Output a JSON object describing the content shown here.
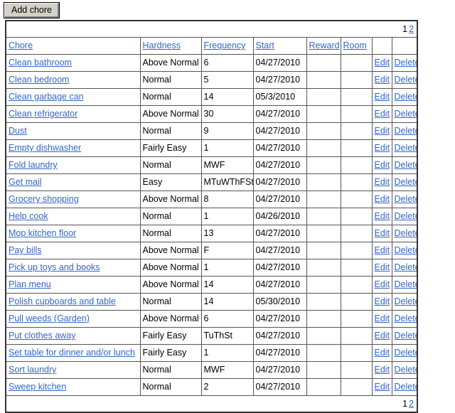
{
  "toolbar": {
    "add_chore_label": "Add chore"
  },
  "pager": {
    "current_page": "1",
    "next_page": "2"
  },
  "table": {
    "columns": [
      {
        "key": "chore",
        "label": "Chore",
        "link": true
      },
      {
        "key": "hard",
        "label": "Hardness",
        "link": true
      },
      {
        "key": "freq",
        "label": "Frequency",
        "link": true
      },
      {
        "key": "start",
        "label": "Start",
        "link": true
      },
      {
        "key": "reward",
        "label": "Reward",
        "link": true
      },
      {
        "key": "room",
        "label": "Room",
        "link": true
      },
      {
        "key": "edit",
        "label": "",
        "link": false
      },
      {
        "key": "delete",
        "label": "",
        "link": false
      }
    ],
    "row_actions": {
      "edit_label": "Edit",
      "delete_label": "Delete"
    },
    "rows": [
      {
        "chore": "Clean bathroom",
        "hardness": "Above Normal",
        "frequency": "6",
        "start": "04/27/2010",
        "reward": "",
        "room": ""
      },
      {
        "chore": "Clean bedroom",
        "hardness": "Normal",
        "frequency": "5",
        "start": "04/27/2010",
        "reward": "",
        "room": ""
      },
      {
        "chore": "Clean garbage can",
        "hardness": "Normal",
        "frequency": "14",
        "start": "05/3/2010",
        "reward": "",
        "room": ""
      },
      {
        "chore": "Clean refrigerator",
        "hardness": "Above Normal",
        "frequency": "30",
        "start": "04/27/2010",
        "reward": "",
        "room": ""
      },
      {
        "chore": "Dust",
        "hardness": "Normal",
        "frequency": "9",
        "start": "04/27/2010",
        "reward": "",
        "room": ""
      },
      {
        "chore": "Empty dishwasher",
        "hardness": "Fairly Easy",
        "frequency": "1",
        "start": "04/27/2010",
        "reward": "",
        "room": ""
      },
      {
        "chore": "Fold laundry",
        "hardness": "Normal",
        "frequency": "MWF",
        "start": "04/27/2010",
        "reward": "",
        "room": ""
      },
      {
        "chore": "Get mail",
        "hardness": "Easy",
        "frequency": "MTuWThFSt",
        "start": "04/27/2010",
        "reward": "",
        "room": ""
      },
      {
        "chore": "Grocery shopping",
        "hardness": "Above Normal",
        "frequency": "8",
        "start": "04/27/2010",
        "reward": "",
        "room": ""
      },
      {
        "chore": "Help cook",
        "hardness": "Normal",
        "frequency": "1",
        "start": "04/26/2010",
        "reward": "",
        "room": ""
      },
      {
        "chore": "Mop kitchen floor",
        "hardness": "Normal",
        "frequency": "13",
        "start": "04/27/2010",
        "reward": "",
        "room": ""
      },
      {
        "chore": "Pay bills",
        "hardness": "Above Normal",
        "frequency": "F",
        "start": "04/27/2010",
        "reward": "",
        "room": ""
      },
      {
        "chore": "Pick up toys and books",
        "hardness": "Above Normal",
        "frequency": "1",
        "start": "04/27/2010",
        "reward": "",
        "room": ""
      },
      {
        "chore": "Plan menu",
        "hardness": "Above Normal",
        "frequency": "14",
        "start": "04/27/2010",
        "reward": "",
        "room": ""
      },
      {
        "chore": "Polish cupboards and table",
        "hardness": "Normal",
        "frequency": "14",
        "start": "05/30/2010",
        "reward": "",
        "room": ""
      },
      {
        "chore": "Pull weeds (Garden)",
        "hardness": "Above Normal",
        "frequency": "6",
        "start": "04/27/2010",
        "reward": "",
        "room": ""
      },
      {
        "chore": "Put clothes away",
        "hardness": "Fairly Easy",
        "frequency": "TuThSt",
        "start": "04/27/2010",
        "reward": "",
        "room": ""
      },
      {
        "chore": "Set table for dinner and/or lunch",
        "hardness": "Fairly Easy",
        "frequency": "1",
        "start": "04/27/2010",
        "reward": "",
        "room": ""
      },
      {
        "chore": "Sort laundry",
        "hardness": "Normal",
        "frequency": "MWF",
        "start": "04/27/2010",
        "reward": "",
        "room": ""
      },
      {
        "chore": "Sweep kitchen",
        "hardness": "Normal",
        "frequency": "2",
        "start": "04/27/2010",
        "reward": "",
        "room": ""
      }
    ]
  },
  "colors": {
    "link": "#3366cc",
    "border": "#555555",
    "table_outer_border": "#333333",
    "button_face": "#d4d0c8"
  }
}
